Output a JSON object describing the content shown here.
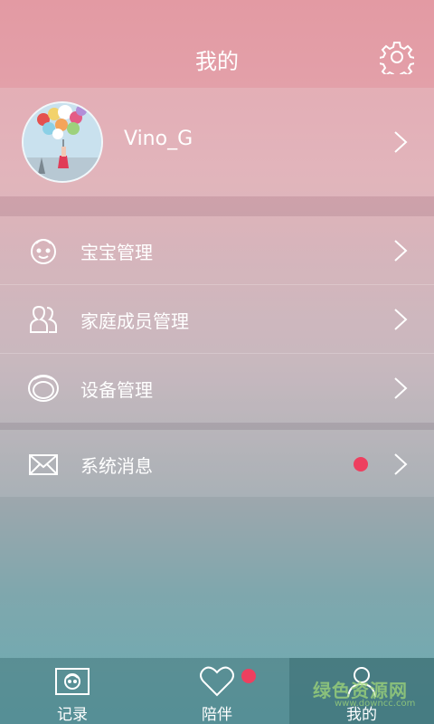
{
  "header": {
    "title": "我的",
    "settings_icon": "gear-icon"
  },
  "profile": {
    "username": "Vino_G",
    "avatar_icon": "avatar-photo"
  },
  "menu": {
    "items": [
      {
        "label": "宝宝管理",
        "icon": "baby-face-icon"
      },
      {
        "label": "家庭成员管理",
        "icon": "family-members-icon"
      },
      {
        "label": "设备管理",
        "icon": "device-icon"
      }
    ],
    "messages": {
      "label": "系统消息",
      "icon": "envelope-icon",
      "has_unread": true
    }
  },
  "tabbar": {
    "tabs": [
      {
        "label": "记录",
        "icon": "record-face-icon"
      },
      {
        "label": "陪伴",
        "icon": "heart-icon",
        "has_badge": true
      },
      {
        "label": "我的",
        "icon": "person-icon",
        "active": true
      }
    ]
  },
  "watermark": {
    "text": "绿色资源网",
    "sub": "www.downcc.com"
  },
  "colors": {
    "badge": "#ee3f5f",
    "header": "#e39aa3"
  }
}
